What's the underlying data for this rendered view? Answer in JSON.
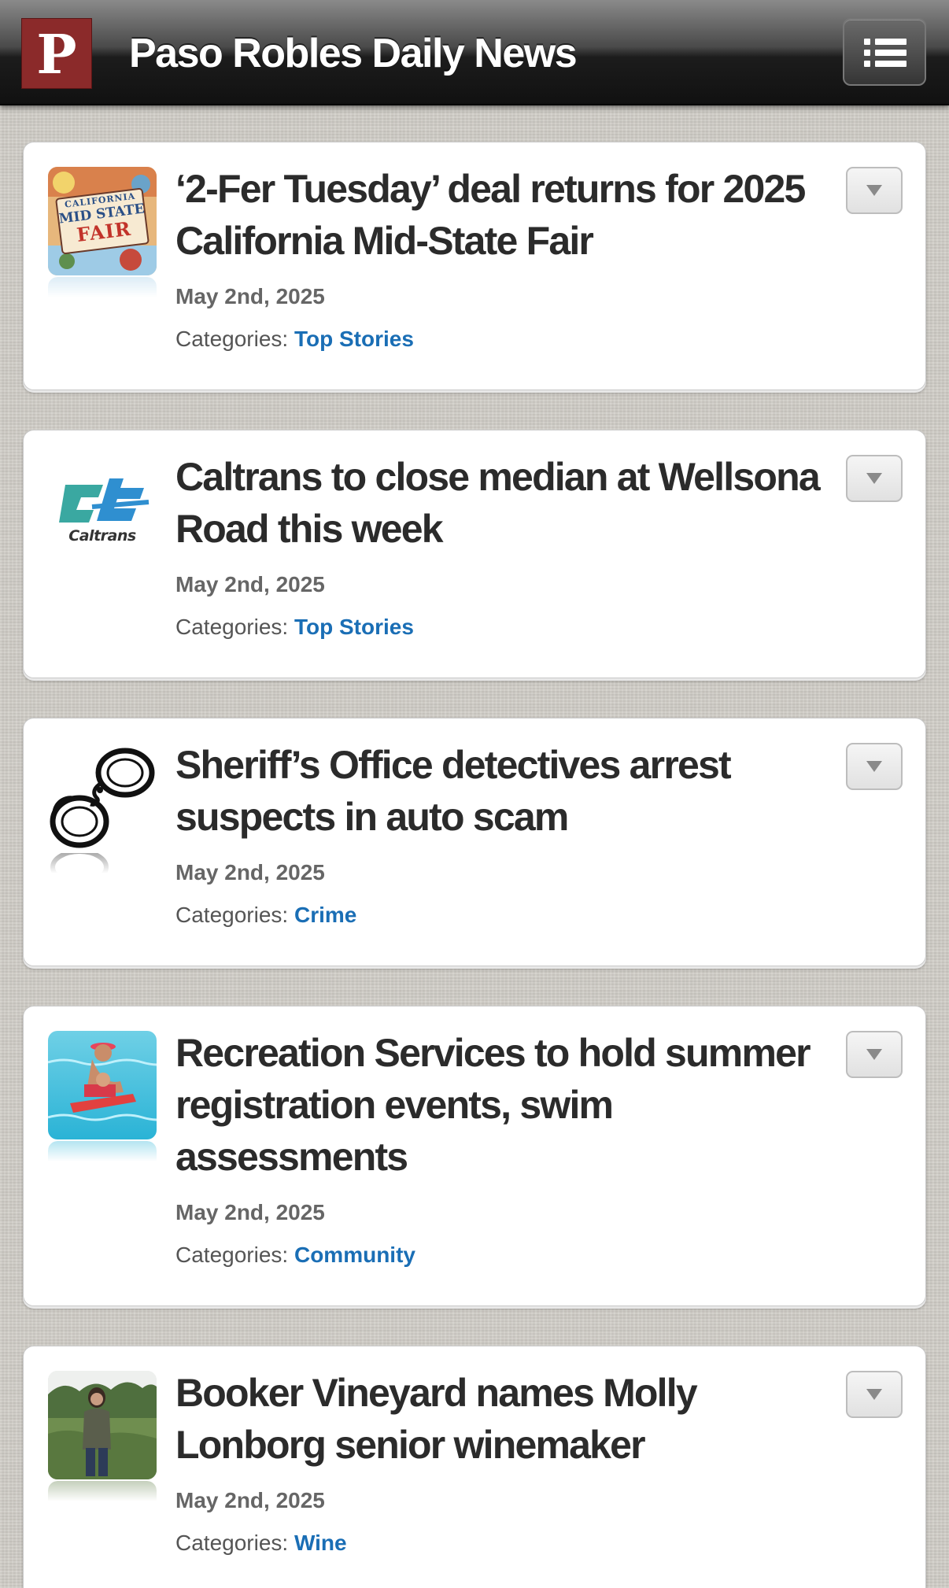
{
  "header": {
    "logo_letter": "P",
    "site_title": "Paso Robles Daily News",
    "menu_icon": "list-menu-icon"
  },
  "articles": [
    {
      "title": "‘2-Fer Tuesday’ deal returns for 2025 California Mid-State Fair",
      "date": "May 2nd, 2025",
      "categories_label": "Categories:",
      "category": "Top Stories",
      "thumbnail": "california-mid-state-fair-logo-image",
      "thumb_text": {
        "line1": "CALIFORNIA",
        "line2": "MID STATE",
        "line3": "FAIR"
      }
    },
    {
      "title": "Caltrans to close median at Wellsona Road this week",
      "date": "May 2nd, 2025",
      "categories_label": "Categories:",
      "category": "Top Stories",
      "thumbnail": "caltrans-logo-image",
      "thumb_text": {
        "line1": "Caltrans"
      }
    },
    {
      "title": "Sheriff’s Office detectives arrest suspects in auto scam",
      "date": "May 2nd, 2025",
      "categories_label": "Categories:",
      "category": "Crime",
      "thumbnail": "handcuffs-image"
    },
    {
      "title": "Recreation Services to hold summer registration events, swim assessments",
      "date": "May 2nd, 2025",
      "categories_label": "Categories:",
      "category": "Community",
      "thumbnail": "swimming-lesson-photo"
    },
    {
      "title": "Booker Vineyard names Molly Lonborg senior winemaker",
      "date": "May 2nd, 2025",
      "categories_label": "Categories:",
      "category": "Wine",
      "thumbnail": "winemaker-in-vineyard-photo"
    }
  ],
  "colors": {
    "header_dark": "#111111",
    "logo_red": "#8b2a2a",
    "category_link": "#1a6eb5",
    "title_text": "#2b2b2b",
    "card_background": "#ffffff"
  }
}
